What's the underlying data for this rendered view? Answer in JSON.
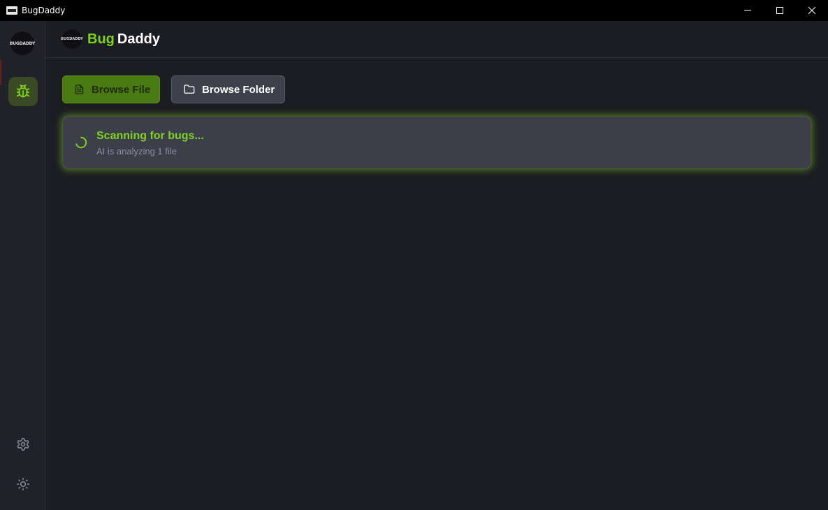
{
  "window": {
    "title": "BugDaddy"
  },
  "rail": {
    "logo_text": "BUGDADDY",
    "items": [
      {
        "icon": "bug-icon",
        "active": true
      },
      {
        "icon": "gear-icon"
      },
      {
        "icon": "sun-icon"
      }
    ]
  },
  "header": {
    "logo_text": "BUGDADDY",
    "brand_part1": "Bug",
    "brand_part2": "Daddy"
  },
  "actions": {
    "browse_file_label": "Browse File",
    "browse_folder_label": "Browse Folder"
  },
  "scan": {
    "title": "Scanning for bugs...",
    "subtitle": "AI is analyzing 1 file"
  },
  "colors": {
    "accent": "#7ed321",
    "background": "#1c1d23",
    "rail": "#212229",
    "card": "#3c3e4a"
  }
}
